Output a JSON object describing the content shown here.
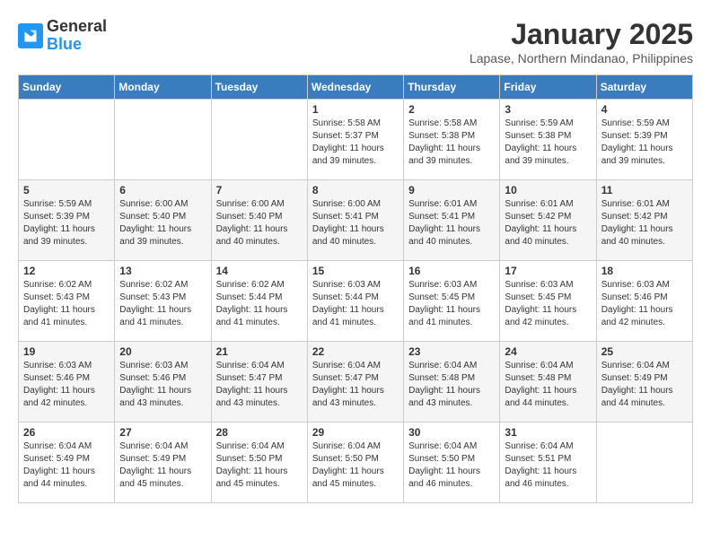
{
  "header": {
    "logo_general": "General",
    "logo_blue": "Blue",
    "month": "January 2025",
    "location": "Lapase, Northern Mindanao, Philippines"
  },
  "weekdays": [
    "Sunday",
    "Monday",
    "Tuesday",
    "Wednesday",
    "Thursday",
    "Friday",
    "Saturday"
  ],
  "weeks": [
    [
      {
        "day": "",
        "info": ""
      },
      {
        "day": "",
        "info": ""
      },
      {
        "day": "",
        "info": ""
      },
      {
        "day": "1",
        "info": "Sunrise: 5:58 AM\nSunset: 5:37 PM\nDaylight: 11 hours and 39 minutes."
      },
      {
        "day": "2",
        "info": "Sunrise: 5:58 AM\nSunset: 5:38 PM\nDaylight: 11 hours and 39 minutes."
      },
      {
        "day": "3",
        "info": "Sunrise: 5:59 AM\nSunset: 5:38 PM\nDaylight: 11 hours and 39 minutes."
      },
      {
        "day": "4",
        "info": "Sunrise: 5:59 AM\nSunset: 5:39 PM\nDaylight: 11 hours and 39 minutes."
      }
    ],
    [
      {
        "day": "5",
        "info": "Sunrise: 5:59 AM\nSunset: 5:39 PM\nDaylight: 11 hours and 39 minutes."
      },
      {
        "day": "6",
        "info": "Sunrise: 6:00 AM\nSunset: 5:40 PM\nDaylight: 11 hours and 39 minutes."
      },
      {
        "day": "7",
        "info": "Sunrise: 6:00 AM\nSunset: 5:40 PM\nDaylight: 11 hours and 40 minutes."
      },
      {
        "day": "8",
        "info": "Sunrise: 6:00 AM\nSunset: 5:41 PM\nDaylight: 11 hours and 40 minutes."
      },
      {
        "day": "9",
        "info": "Sunrise: 6:01 AM\nSunset: 5:41 PM\nDaylight: 11 hours and 40 minutes."
      },
      {
        "day": "10",
        "info": "Sunrise: 6:01 AM\nSunset: 5:42 PM\nDaylight: 11 hours and 40 minutes."
      },
      {
        "day": "11",
        "info": "Sunrise: 6:01 AM\nSunset: 5:42 PM\nDaylight: 11 hours and 40 minutes."
      }
    ],
    [
      {
        "day": "12",
        "info": "Sunrise: 6:02 AM\nSunset: 5:43 PM\nDaylight: 11 hours and 41 minutes."
      },
      {
        "day": "13",
        "info": "Sunrise: 6:02 AM\nSunset: 5:43 PM\nDaylight: 11 hours and 41 minutes."
      },
      {
        "day": "14",
        "info": "Sunrise: 6:02 AM\nSunset: 5:44 PM\nDaylight: 11 hours and 41 minutes."
      },
      {
        "day": "15",
        "info": "Sunrise: 6:03 AM\nSunset: 5:44 PM\nDaylight: 11 hours and 41 minutes."
      },
      {
        "day": "16",
        "info": "Sunrise: 6:03 AM\nSunset: 5:45 PM\nDaylight: 11 hours and 41 minutes."
      },
      {
        "day": "17",
        "info": "Sunrise: 6:03 AM\nSunset: 5:45 PM\nDaylight: 11 hours and 42 minutes."
      },
      {
        "day": "18",
        "info": "Sunrise: 6:03 AM\nSunset: 5:46 PM\nDaylight: 11 hours and 42 minutes."
      }
    ],
    [
      {
        "day": "19",
        "info": "Sunrise: 6:03 AM\nSunset: 5:46 PM\nDaylight: 11 hours and 42 minutes."
      },
      {
        "day": "20",
        "info": "Sunrise: 6:03 AM\nSunset: 5:46 PM\nDaylight: 11 hours and 43 minutes."
      },
      {
        "day": "21",
        "info": "Sunrise: 6:04 AM\nSunset: 5:47 PM\nDaylight: 11 hours and 43 minutes."
      },
      {
        "day": "22",
        "info": "Sunrise: 6:04 AM\nSunset: 5:47 PM\nDaylight: 11 hours and 43 minutes."
      },
      {
        "day": "23",
        "info": "Sunrise: 6:04 AM\nSunset: 5:48 PM\nDaylight: 11 hours and 43 minutes."
      },
      {
        "day": "24",
        "info": "Sunrise: 6:04 AM\nSunset: 5:48 PM\nDaylight: 11 hours and 44 minutes."
      },
      {
        "day": "25",
        "info": "Sunrise: 6:04 AM\nSunset: 5:49 PM\nDaylight: 11 hours and 44 minutes."
      }
    ],
    [
      {
        "day": "26",
        "info": "Sunrise: 6:04 AM\nSunset: 5:49 PM\nDaylight: 11 hours and 44 minutes."
      },
      {
        "day": "27",
        "info": "Sunrise: 6:04 AM\nSunset: 5:49 PM\nDaylight: 11 hours and 45 minutes."
      },
      {
        "day": "28",
        "info": "Sunrise: 6:04 AM\nSunset: 5:50 PM\nDaylight: 11 hours and 45 minutes."
      },
      {
        "day": "29",
        "info": "Sunrise: 6:04 AM\nSunset: 5:50 PM\nDaylight: 11 hours and 45 minutes."
      },
      {
        "day": "30",
        "info": "Sunrise: 6:04 AM\nSunset: 5:50 PM\nDaylight: 11 hours and 46 minutes."
      },
      {
        "day": "31",
        "info": "Sunrise: 6:04 AM\nSunset: 5:51 PM\nDaylight: 11 hours and 46 minutes."
      },
      {
        "day": "",
        "info": ""
      }
    ]
  ]
}
